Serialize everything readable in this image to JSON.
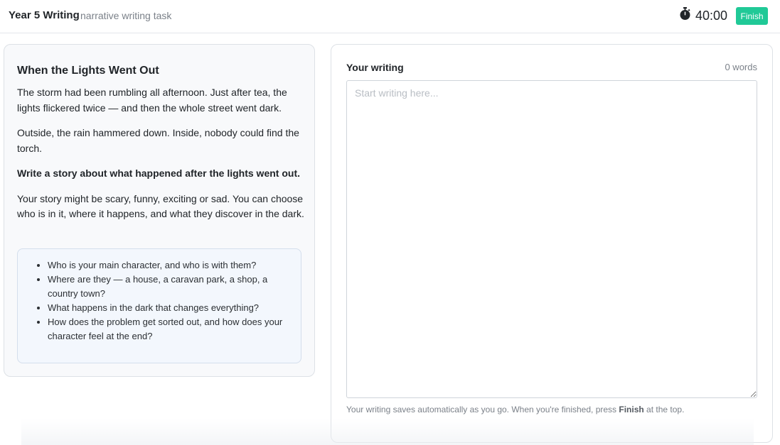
{
  "header": {
    "title": "Year 5 Writing",
    "subtitle": "narrative writing task",
    "timer_icon": "stopwatch-icon",
    "timer": "40:00",
    "finish_label": "Finish",
    "finish_color": "#20c997"
  },
  "task": {
    "title": "When the Lights Went Out",
    "paragraphs": [
      "The storm had been rumbling all afternoon. Just after tea, the lights flickered twice — and then the whole street went dark.",
      "Outside, the rain hammered down. Inside, nobody could find the torch.",
      "Write a story about what happened after the lights went out.",
      "Your story might be scary, funny, exciting or sad. You can choose who is in it, where it happens, and what they discover in the dark."
    ],
    "tips": [
      "Who is your main character, and who is with them?",
      "Where are they — a house, a caravan park, a shop, a country town?",
      "What happens in the dark that changes everything?",
      "How does the problem get sorted out, and how does your character feel at the end?"
    ]
  },
  "writing": {
    "label": "Your writing",
    "word_count": "0 words",
    "value": "",
    "placeholder": "Start writing here...",
    "note_before": "Your writing saves automatically as you go. When you're finished, press ",
    "note_bold": "Finish",
    "note_after": " at the top."
  }
}
